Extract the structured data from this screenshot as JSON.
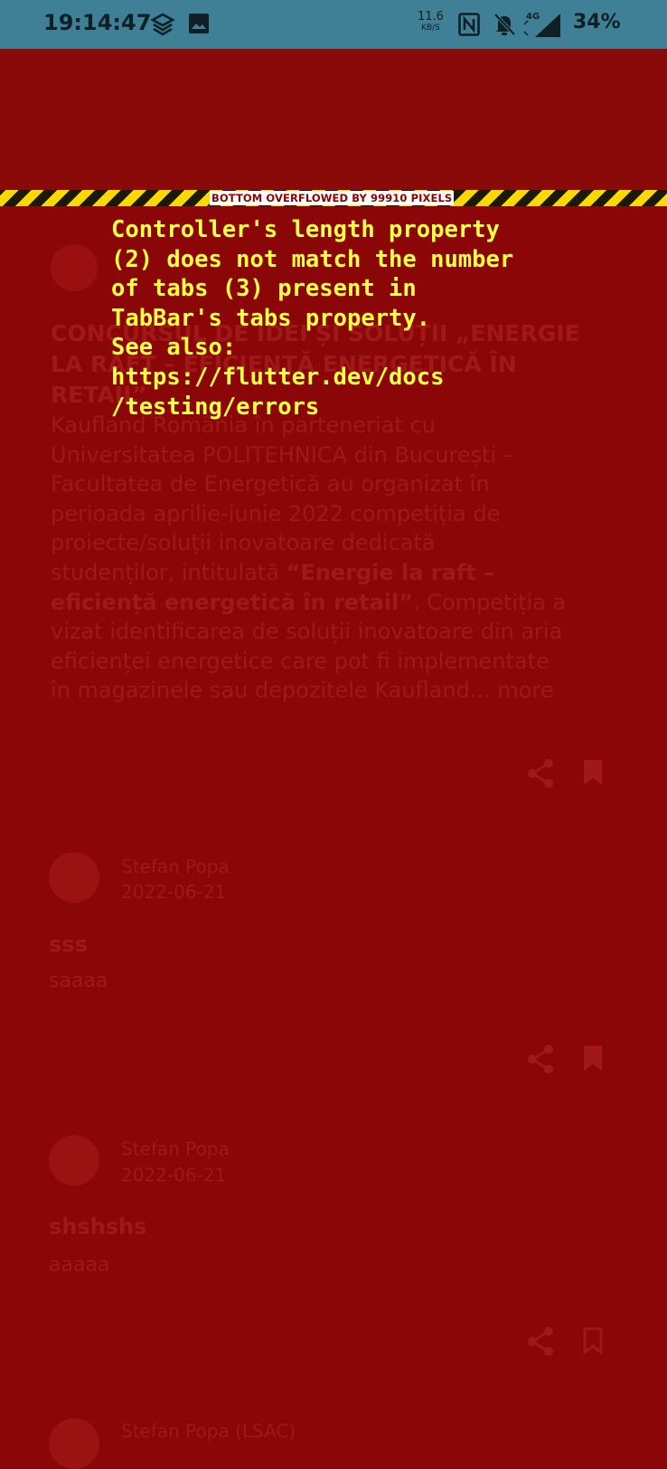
{
  "status_bar": {
    "time": "19:14:47",
    "speed_value": "11.6",
    "speed_unit": "KB/S",
    "network": "4G",
    "battery": "34%"
  },
  "overflow_banner": "BOTTOM OVERFLOWED BY 99910 PIXELS",
  "error_message": "Controller's length property\n(2) does not match the number\nof tabs (3) present in\nTabBar's tabs property.\nSee also:\nhttps://flutter.dev/docs\n/testing/errors",
  "article": {
    "headline_lines": [
      "CONCURSUL DE IDEI ȘI SOLUȚII „ENERGIE",
      "LA RAFT – EFICIENȚĂ ENERGETICĂ ÎN",
      "RETAIL”"
    ],
    "body_lines": [
      "Kaufland România în parteneriat cu",
      "Universitatea POLITEHNICA din București –",
      "Facultatea de Energetică au organizat în",
      "perioada aprilie-iunie 2022 competiția de",
      "proiecte/soluții inovatoare dedicată",
      "studenților, intitulată",
      "“Energie la raft –",
      "eficiență energetică în retail”",
      ". Competiția a",
      "vizat identificarea de soluții inovatoare din aria",
      "eficienței energetice care pot fi implementate",
      "în magazinele sau depozitele Kaufland...",
      "more"
    ]
  },
  "posts": [
    {
      "author": "Stefan Popa",
      "date": "2022-06-21",
      "title": "sss",
      "body": "saaaa"
    },
    {
      "author": "Stefan Popa",
      "date": "2022-06-21",
      "title": "shshshs",
      "body": "aaaaa"
    },
    {
      "author": "Stefan Popa (LSAC)"
    }
  ],
  "colors": {
    "error_background": "#8b0606",
    "status_bar": "#3f8096",
    "error_text": "#ffff44"
  }
}
